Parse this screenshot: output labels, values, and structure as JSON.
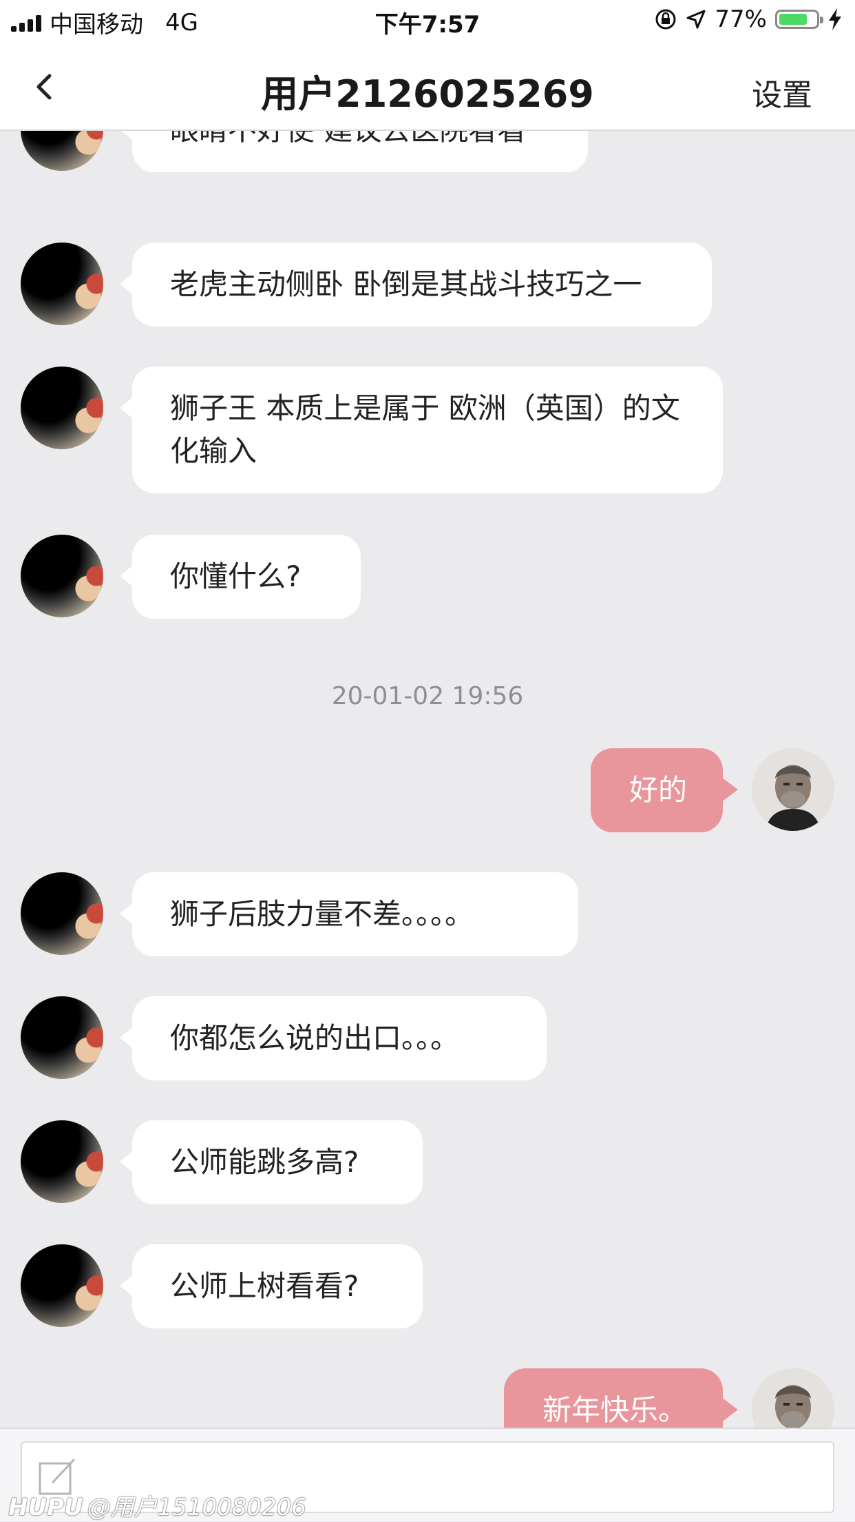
{
  "status_bar": {
    "carrier": "中国移动",
    "network": "4G",
    "time": "下午7:57",
    "battery_percent": "77%",
    "battery_level": 0.77
  },
  "nav": {
    "title": "用户2126025269",
    "settings_label": "设置"
  },
  "messages": [
    {
      "side": "in",
      "text": "眼睛不好使 建议去医院看看"
    },
    {
      "side": "in",
      "text": "老虎主动侧卧 卧倒是其战斗技巧之一"
    },
    {
      "side": "in",
      "text": "狮子王 本质上是属于 欧洲（英国）的文化输入"
    },
    {
      "side": "in",
      "text": "你懂什么?"
    },
    {
      "type": "timestamp",
      "text": "20-01-02 19:56"
    },
    {
      "side": "out",
      "text": "好的"
    },
    {
      "side": "in",
      "text": "狮子后肢力量不差。。。。"
    },
    {
      "side": "in",
      "text": "你都怎么说的出口。。。"
    },
    {
      "side": "in",
      "text": "公师能跳多高?"
    },
    {
      "side": "in",
      "text": "公师上树看看?"
    },
    {
      "side": "out",
      "text": "新年快乐。"
    }
  ],
  "watermark": {
    "brand": "HUPU",
    "user": "@用户1510080206"
  },
  "icons": {
    "back": "chevron-left-icon",
    "compose": "compose-icon",
    "orientation_lock": "orientation-lock-icon",
    "location": "location-arrow-icon",
    "charging": "charging-bolt-icon"
  },
  "colors": {
    "outgoing_bubble": "#e8959b",
    "incoming_bubble": "#ffffff",
    "background": "#ebebed",
    "battery": "#4cd964"
  }
}
